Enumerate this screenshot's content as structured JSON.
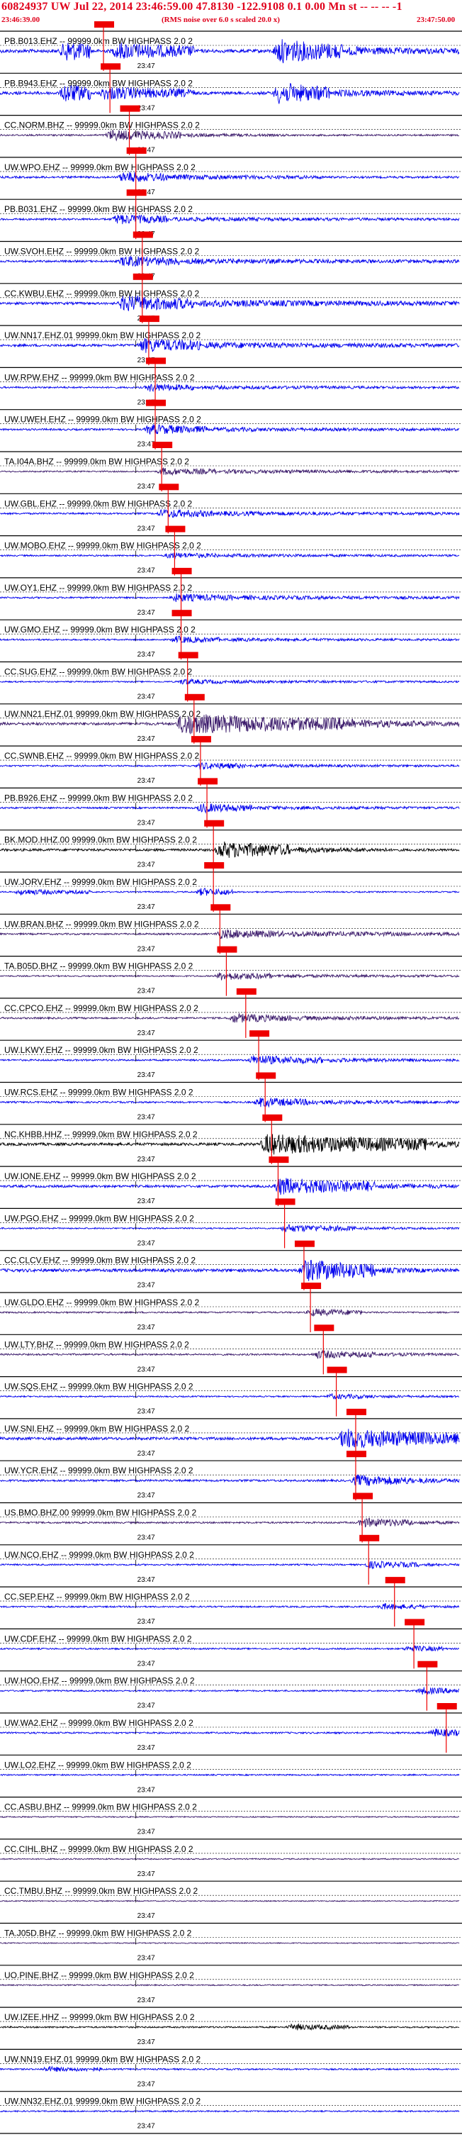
{
  "header": {
    "title": "60824937 UW Jul 22, 2014 23:46:59.00   47.8130 -122.9108  0.1 0.00 Mn st -- -- --  -1",
    "start_time": "23:46:39.00",
    "note": "(RMS noise over 6.0 s scaled 20.0 x)",
    "end_time": "23:47:50.00"
  },
  "colors": {
    "trace_blue": "#0000ee",
    "trace_purple": "#3b1a6b",
    "trace_black": "#000000",
    "pick_red": "#ee0000",
    "header_red": "#e0001b"
  },
  "chart_data": {
    "type": "line",
    "title": "60824937 UW Jul 22, 2014 23:46:59.00   47.8130 -122.9108  0.1 0.00 Mn st -- -- --  -1",
    "xlim": [
      "23:46:39.00",
      "23:47:50.00"
    ],
    "tick_label": "23:47",
    "grid": true,
    "series": [
      {
        "name": "PB.B013.EHZ -- 99999.0km BW HIGHPASS 2.0 2",
        "color": "#0000ee",
        "amp": 20,
        "pick": 16,
        "bursts": [
          [
            9,
            14,
            1.0
          ],
          [
            17,
            30,
            0.7
          ],
          [
            42,
            53,
            1.0
          ],
          [
            53,
            71,
            0.35
          ]
        ]
      },
      {
        "name": "PB.B943.EHZ -- 99999.0km BW HIGHPASS 2.0 2",
        "color": "#0000ee",
        "amp": 18,
        "pick": 17,
        "bursts": [
          [
            9,
            14,
            1.0
          ],
          [
            15,
            30,
            0.6
          ],
          [
            42,
            51,
            1.0
          ],
          [
            51,
            71,
            0.3
          ]
        ]
      },
      {
        "name": "CC.NORM.BHZ -- 99999.0km BW HIGHPASS 2.0 2",
        "color": "#3b1a6b",
        "amp": 10,
        "pick": 20,
        "bursts": [
          [
            16,
            28,
            0.9
          ],
          [
            28,
            45,
            0.3
          ]
        ]
      },
      {
        "name": "UW.WPO.EHZ -- 99999.0km BW HIGHPASS 2.0 2",
        "color": "#0000ee",
        "amp": 12,
        "pick": 21,
        "bursts": [
          [
            18,
            26,
            0.8
          ],
          [
            26,
            50,
            0.35
          ]
        ]
      },
      {
        "name": "PB.B031.EHZ -- 99999.0km BW HIGHPASS 2.0 2",
        "color": "#0000ee",
        "amp": 11,
        "pick": 21,
        "bursts": [
          [
            17,
            26,
            0.8
          ],
          [
            26,
            71,
            0.3
          ]
        ]
      },
      {
        "name": "UW.SVOH.EHZ -- 99999.0km BW HIGHPASS 2.0 2",
        "color": "#0000ee",
        "amp": 12,
        "pick": 22,
        "bursts": [
          [
            18,
            28,
            0.8
          ],
          [
            28,
            71,
            0.35
          ]
        ]
      },
      {
        "name": "CC.KWBU.EHZ -- 99999.0km BW HIGHPASS 2.0 2",
        "color": "#0000ee",
        "amp": 14,
        "pick": 22,
        "bursts": [
          [
            18,
            30,
            1.0
          ],
          [
            30,
            71,
            0.4
          ]
        ]
      },
      {
        "name": "UW.NN17.EHZ.01 99999.0km BW HIGHPASS 2.0 2",
        "color": "#0000ee",
        "amp": 14,
        "pick": 23,
        "bursts": [
          [
            21,
            31,
            0.9
          ],
          [
            31,
            71,
            0.35
          ]
        ]
      },
      {
        "name": "UW.RPW.EHZ -- 99999.0km BW HIGHPASS 2.0 2",
        "color": "#0000ee",
        "amp": 10,
        "pick": 24,
        "bursts": [
          [
            22,
            30,
            0.7
          ],
          [
            30,
            71,
            0.3
          ]
        ]
      },
      {
        "name": "UW.UWEH.EHZ -- 99999.0km BW HIGHPASS 2.0 2",
        "color": "#0000ee",
        "amp": 11,
        "pick": 24,
        "bursts": [
          [
            22,
            32,
            0.8
          ],
          [
            32,
            71,
            0.3
          ]
        ]
      },
      {
        "name": "TA.I04A.BHZ -- 99999.0km BW HIGHPASS 2.0 2",
        "color": "#3b1a6b",
        "amp": 8,
        "pick": 25,
        "bursts": [
          [
            24,
            34,
            0.8
          ],
          [
            34,
            71,
            0.4
          ]
        ]
      },
      {
        "name": "UW.GBL.EHZ -- 99999.0km BW HIGHPASS 2.0 2",
        "color": "#0000ee",
        "amp": 10,
        "pick": 26,
        "bursts": [
          [
            24,
            33,
            0.8
          ],
          [
            33,
            71,
            0.35
          ]
        ]
      },
      {
        "name": "UW.MOBO.EHZ -- 99999.0km BW HIGHPASS 2.0 2",
        "color": "#0000ee",
        "amp": 9,
        "pick": 27,
        "bursts": [
          [
            25,
            34,
            0.6
          ],
          [
            34,
            71,
            0.3
          ]
        ]
      },
      {
        "name": "UW.OY1.EHZ -- 99999.0km BW HIGHPASS 2.0 2",
        "color": "#0000ee",
        "amp": 10,
        "pick": 28,
        "bursts": [
          [
            26,
            36,
            0.7
          ],
          [
            36,
            71,
            0.35
          ]
        ]
      },
      {
        "name": "UW.GMO.EHZ -- 99999.0km BW HIGHPASS 2.0 2",
        "color": "#0000ee",
        "amp": 9,
        "pick": 28,
        "bursts": [
          [
            26,
            34,
            0.7
          ],
          [
            34,
            71,
            0.3
          ]
        ]
      },
      {
        "name": "CC.SUG.EHZ -- 99999.0km BW HIGHPASS 2.0 2",
        "color": "#0000ee",
        "amp": 8,
        "pick": 29,
        "bursts": [
          [
            27,
            35,
            0.6
          ],
          [
            35,
            71,
            0.3
          ]
        ]
      },
      {
        "name": "UW.NN21.EHZ.01 99999.0km BW HIGHPASS 2.0 2",
        "color": "#3b1a6b",
        "amp": 16,
        "pick": 30,
        "bursts": [
          [
            27,
            55,
            1.0
          ],
          [
            55,
            71,
            0.4
          ]
        ]
      },
      {
        "name": "CC.SWNB.EHZ -- 99999.0km BW HIGHPASS 2.0 2",
        "color": "#0000ee",
        "amp": 9,
        "pick": 31,
        "bursts": [
          [
            30,
            38,
            0.7
          ],
          [
            38,
            71,
            0.3
          ]
        ]
      },
      {
        "name": "PB.B926.EHZ -- 99999.0km BW HIGHPASS 2.0 2",
        "color": "#0000ee",
        "amp": 10,
        "pick": 32,
        "bursts": [
          [
            30,
            39,
            0.8
          ],
          [
            39,
            71,
            0.3
          ]
        ]
      },
      {
        "name": "BK.MOD.HHZ.00 99999.0km BW HIGHPASS 2.0 2",
        "color": "#000000",
        "amp": 14,
        "pick": 33,
        "bursts": [
          [
            33,
            45,
            1.0
          ],
          [
            45,
            60,
            0.35
          ]
        ]
      },
      {
        "name": "UW.JORV.EHZ -- 99999.0km BW HIGHPASS 2.0 2",
        "color": "#0000ee",
        "amp": 8,
        "pick": 33,
        "bursts": [
          [
            2,
            14,
            0.6
          ],
          [
            30,
            36,
            0.9
          ]
        ]
      },
      {
        "name": "UW.BRAN.BHZ -- 99999.0km BW HIGHPASS 2.0 2",
        "color": "#3b1a6b",
        "amp": 10,
        "pick": 34,
        "bursts": [
          [
            33,
            44,
            0.8
          ],
          [
            44,
            71,
            0.45
          ]
        ]
      },
      {
        "name": "TA.B05D.BHZ -- 99999.0km BW HIGHPASS 2.0 2",
        "color": "#3b1a6b",
        "amp": 8,
        "pick": 35,
        "bursts": [
          [
            33,
            42,
            0.9
          ],
          [
            42,
            71,
            0.35
          ]
        ]
      },
      {
        "name": "CC.CPCO.EHZ -- 99999.0km BW HIGHPASS 2.0 2",
        "color": "#3b1a6b",
        "amp": 10,
        "pick": 38,
        "bursts": [
          [
            35,
            45,
            0.8
          ],
          [
            45,
            71,
            0.35
          ]
        ]
      },
      {
        "name": "UW.LKWY.EHZ -- 99999.0km BW HIGHPASS 2.0 2",
        "color": "#0000ee",
        "amp": 10,
        "pick": 40,
        "bursts": [
          [
            38,
            50,
            0.8
          ],
          [
            50,
            71,
            0.35
          ]
        ]
      },
      {
        "name": "UW.RCS.EHZ -- 99999.0km BW HIGHPASS 2.0 2",
        "color": "#0000ee",
        "amp": 10,
        "pick": 41,
        "bursts": [
          [
            39,
            49,
            0.8
          ],
          [
            49,
            71,
            0.35
          ]
        ]
      },
      {
        "name": "NC.KHBB.HHZ -- 99999.0km BW HIGHPASS 2.0 2",
        "color": "#000000",
        "amp": 16,
        "pick": 42,
        "bursts": [
          [
            40,
            66,
            1.0
          ],
          [
            66,
            71,
            0.5
          ]
        ]
      },
      {
        "name": "UW.IONE.EHZ -- 99999.0km BW HIGHPASS 2.0 2",
        "color": "#0000ee",
        "amp": 14,
        "pick": 43,
        "bursts": [
          [
            42,
            58,
            1.0
          ],
          [
            58,
            71,
            0.35
          ]
        ]
      },
      {
        "name": "UW.PGO.EHZ -- 99999.0km BW HIGHPASS 2.0 2",
        "color": "#0000ee",
        "amp": 8,
        "pick": 44,
        "bursts": [
          [
            43,
            55,
            0.8
          ],
          [
            55,
            71,
            0.3
          ]
        ]
      },
      {
        "name": "CC.CLCV.EHZ -- 99999.0km BW HIGHPASS 2.0 2",
        "color": "#0000ee",
        "amp": 18,
        "pick": 47,
        "bursts": [
          [
            46,
            58,
            1.0
          ],
          [
            58,
            71,
            0.25
          ]
        ]
      },
      {
        "name": "UW.GLDO.EHZ -- 99999.0km BW HIGHPASS 2.0 2",
        "color": "#3b1a6b",
        "amp": 9,
        "pick": 48,
        "bursts": [
          [
            47,
            56,
            0.7
          ]
        ]
      },
      {
        "name": "UW.LTY.BHZ -- 99999.0km BW HIGHPASS 2.0 2",
        "color": "#3b1a6b",
        "amp": 10,
        "pick": 50,
        "bursts": [
          [
            48,
            58,
            0.7
          ],
          [
            58,
            71,
            0.3
          ]
        ]
      },
      {
        "name": "UW.SQS.EHZ -- 99999.0km BW HIGHPASS 2.0 2",
        "color": "#0000ee",
        "amp": 8,
        "pick": 52,
        "bursts": [
          [
            50,
            58,
            0.6
          ],
          [
            58,
            71,
            0.3
          ]
        ]
      },
      {
        "name": "UW.SNI.EHZ -- 99999.0km BW HIGHPASS 2.0 2",
        "color": "#0000ee",
        "amp": 16,
        "pick": 55,
        "bursts": [
          [
            52,
            71,
            1.0
          ]
        ]
      },
      {
        "name": "UW.YCR.EHZ -- 99999.0km BW HIGHPASS 2.0 2",
        "color": "#0000ee",
        "amp": 12,
        "pick": 55,
        "bursts": [
          [
            54,
            64,
            0.8
          ],
          [
            64,
            71,
            0.4
          ]
        ]
      },
      {
        "name": "US.BMO.BHZ.00 99999.0km BW HIGHPASS 2.0 2",
        "color": "#3b1a6b",
        "amp": 10,
        "pick": 56,
        "bursts": [
          [
            55,
            64,
            0.8
          ],
          [
            64,
            71,
            0.35
          ]
        ]
      },
      {
        "name": "UW.NCO.EHZ -- 99999.0km BW HIGHPASS 2.0 2",
        "color": "#0000ee",
        "amp": 9,
        "pick": 57,
        "bursts": [
          [
            56,
            65,
            0.7
          ],
          [
            65,
            71,
            0.3
          ]
        ]
      },
      {
        "name": "CC.SEP.EHZ -- 99999.0km BW HIGHPASS 2.0 2",
        "color": "#0000ee",
        "amp": 9,
        "pick": 61,
        "bursts": [
          [
            58,
            66,
            0.6
          ],
          [
            66,
            71,
            0.3
          ]
        ]
      },
      {
        "name": "UW.CDF.EHZ -- 99999.0km BW HIGHPASS 2.0 2",
        "color": "#0000ee",
        "amp": 9,
        "pick": 64,
        "bursts": [
          [
            62,
            69,
            0.6
          ]
        ]
      },
      {
        "name": "UW.HOO.EHZ -- 99999.0km BW HIGHPASS 2.0 2",
        "color": "#0000ee",
        "amp": 9,
        "pick": 66,
        "bursts": [
          [
            64,
            71,
            0.7
          ]
        ]
      },
      {
        "name": "UW.WA2.EHZ -- 99999.0km BW HIGHPASS 2.0 2",
        "color": "#0000ee",
        "amp": 10,
        "pick": 69,
        "bursts": [
          [
            66,
            71,
            0.8
          ]
        ]
      },
      {
        "name": "UW.LO2.EHZ -- 99999.0km BW HIGHPASS 2.0 2",
        "color": "#0000ee",
        "amp": 8,
        "pick": null,
        "bursts": []
      },
      {
        "name": "CC.ASBU.BHZ -- 99999.0km BW HIGHPASS 2.0 2",
        "color": "#3b1a6b",
        "amp": 7,
        "pick": null,
        "bursts": []
      },
      {
        "name": "CC.CIHL.BHZ -- 99999.0km BW HIGHPASS 2.0 2",
        "color": "#3b1a6b",
        "amp": 7,
        "pick": null,
        "bursts": []
      },
      {
        "name": "CC.TMBU.BHZ -- 99999.0km BW HIGHPASS 2.0 2",
        "color": "#3b1a6b",
        "amp": 6,
        "pick": null,
        "bursts": []
      },
      {
        "name": "TA.J05D.BHZ -- 99999.0km BW HIGHPASS 2.0 2",
        "color": "#3b1a6b",
        "amp": 6,
        "pick": null,
        "bursts": []
      },
      {
        "name": "UO.PINE.BHZ -- 99999.0km BW HIGHPASS 2.0 2",
        "color": "#3b1a6b",
        "amp": 7,
        "pick": null,
        "bursts": []
      },
      {
        "name": "UW.IZEE.HHZ -- 99999.0km BW HIGHPASS 2.0 2",
        "color": "#000000",
        "amp": 9,
        "pick": null,
        "bursts": [
          [
            44,
            54,
            0.6
          ]
        ]
      },
      {
        "name": "UW.NN19.EHZ.01 99999.0km BW HIGHPASS 2.0 2",
        "color": "#0000ee",
        "amp": 9,
        "pick": null,
        "bursts": [
          [
            6,
            16,
            0.5
          ]
        ]
      },
      {
        "name": "UW.NN32.EHZ.01 99999.0km BW HIGHPASS 2.0 2",
        "color": "#0000ee",
        "amp": 8,
        "pick": null,
        "bursts": []
      }
    ]
  }
}
